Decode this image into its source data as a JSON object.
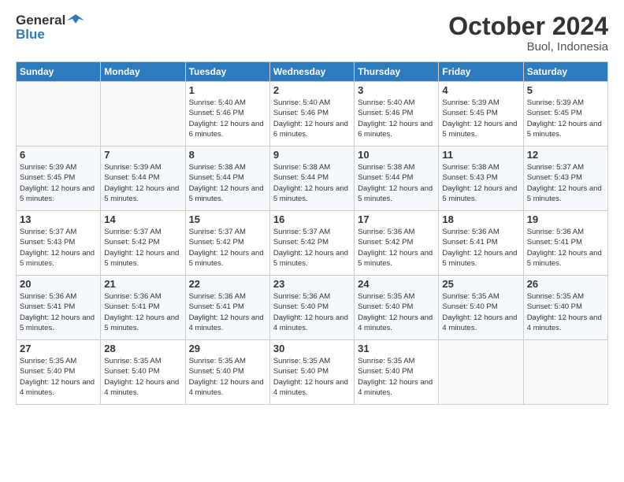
{
  "logo": {
    "text_general": "General",
    "text_blue": "Blue"
  },
  "title": "October 2024",
  "subtitle": "Buol, Indonesia",
  "days_of_week": [
    "Sunday",
    "Monday",
    "Tuesday",
    "Wednesday",
    "Thursday",
    "Friday",
    "Saturday"
  ],
  "weeks": [
    [
      {
        "day": "",
        "sunrise": "",
        "sunset": "",
        "daylight": ""
      },
      {
        "day": "",
        "sunrise": "",
        "sunset": "",
        "daylight": ""
      },
      {
        "day": "1",
        "sunrise": "Sunrise: 5:40 AM",
        "sunset": "Sunset: 5:46 PM",
        "daylight": "Daylight: 12 hours and 6 minutes."
      },
      {
        "day": "2",
        "sunrise": "Sunrise: 5:40 AM",
        "sunset": "Sunset: 5:46 PM",
        "daylight": "Daylight: 12 hours and 6 minutes."
      },
      {
        "day": "3",
        "sunrise": "Sunrise: 5:40 AM",
        "sunset": "Sunset: 5:46 PM",
        "daylight": "Daylight: 12 hours and 6 minutes."
      },
      {
        "day": "4",
        "sunrise": "Sunrise: 5:39 AM",
        "sunset": "Sunset: 5:45 PM",
        "daylight": "Daylight: 12 hours and 5 minutes."
      },
      {
        "day": "5",
        "sunrise": "Sunrise: 5:39 AM",
        "sunset": "Sunset: 5:45 PM",
        "daylight": "Daylight: 12 hours and 5 minutes."
      }
    ],
    [
      {
        "day": "6",
        "sunrise": "Sunrise: 5:39 AM",
        "sunset": "Sunset: 5:45 PM",
        "daylight": "Daylight: 12 hours and 5 minutes."
      },
      {
        "day": "7",
        "sunrise": "Sunrise: 5:39 AM",
        "sunset": "Sunset: 5:44 PM",
        "daylight": "Daylight: 12 hours and 5 minutes."
      },
      {
        "day": "8",
        "sunrise": "Sunrise: 5:38 AM",
        "sunset": "Sunset: 5:44 PM",
        "daylight": "Daylight: 12 hours and 5 minutes."
      },
      {
        "day": "9",
        "sunrise": "Sunrise: 5:38 AM",
        "sunset": "Sunset: 5:44 PM",
        "daylight": "Daylight: 12 hours and 5 minutes."
      },
      {
        "day": "10",
        "sunrise": "Sunrise: 5:38 AM",
        "sunset": "Sunset: 5:44 PM",
        "daylight": "Daylight: 12 hours and 5 minutes."
      },
      {
        "day": "11",
        "sunrise": "Sunrise: 5:38 AM",
        "sunset": "Sunset: 5:43 PM",
        "daylight": "Daylight: 12 hours and 5 minutes."
      },
      {
        "day": "12",
        "sunrise": "Sunrise: 5:37 AM",
        "sunset": "Sunset: 5:43 PM",
        "daylight": "Daylight: 12 hours and 5 minutes."
      }
    ],
    [
      {
        "day": "13",
        "sunrise": "Sunrise: 5:37 AM",
        "sunset": "Sunset: 5:43 PM",
        "daylight": "Daylight: 12 hours and 5 minutes."
      },
      {
        "day": "14",
        "sunrise": "Sunrise: 5:37 AM",
        "sunset": "Sunset: 5:42 PM",
        "daylight": "Daylight: 12 hours and 5 minutes."
      },
      {
        "day": "15",
        "sunrise": "Sunrise: 5:37 AM",
        "sunset": "Sunset: 5:42 PM",
        "daylight": "Daylight: 12 hours and 5 minutes."
      },
      {
        "day": "16",
        "sunrise": "Sunrise: 5:37 AM",
        "sunset": "Sunset: 5:42 PM",
        "daylight": "Daylight: 12 hours and 5 minutes."
      },
      {
        "day": "17",
        "sunrise": "Sunrise: 5:36 AM",
        "sunset": "Sunset: 5:42 PM",
        "daylight": "Daylight: 12 hours and 5 minutes."
      },
      {
        "day": "18",
        "sunrise": "Sunrise: 5:36 AM",
        "sunset": "Sunset: 5:41 PM",
        "daylight": "Daylight: 12 hours and 5 minutes."
      },
      {
        "day": "19",
        "sunrise": "Sunrise: 5:36 AM",
        "sunset": "Sunset: 5:41 PM",
        "daylight": "Daylight: 12 hours and 5 minutes."
      }
    ],
    [
      {
        "day": "20",
        "sunrise": "Sunrise: 5:36 AM",
        "sunset": "Sunset: 5:41 PM",
        "daylight": "Daylight: 12 hours and 5 minutes."
      },
      {
        "day": "21",
        "sunrise": "Sunrise: 5:36 AM",
        "sunset": "Sunset: 5:41 PM",
        "daylight": "Daylight: 12 hours and 5 minutes."
      },
      {
        "day": "22",
        "sunrise": "Sunrise: 5:36 AM",
        "sunset": "Sunset: 5:41 PM",
        "daylight": "Daylight: 12 hours and 4 minutes."
      },
      {
        "day": "23",
        "sunrise": "Sunrise: 5:36 AM",
        "sunset": "Sunset: 5:40 PM",
        "daylight": "Daylight: 12 hours and 4 minutes."
      },
      {
        "day": "24",
        "sunrise": "Sunrise: 5:35 AM",
        "sunset": "Sunset: 5:40 PM",
        "daylight": "Daylight: 12 hours and 4 minutes."
      },
      {
        "day": "25",
        "sunrise": "Sunrise: 5:35 AM",
        "sunset": "Sunset: 5:40 PM",
        "daylight": "Daylight: 12 hours and 4 minutes."
      },
      {
        "day": "26",
        "sunrise": "Sunrise: 5:35 AM",
        "sunset": "Sunset: 5:40 PM",
        "daylight": "Daylight: 12 hours and 4 minutes."
      }
    ],
    [
      {
        "day": "27",
        "sunrise": "Sunrise: 5:35 AM",
        "sunset": "Sunset: 5:40 PM",
        "daylight": "Daylight: 12 hours and 4 minutes."
      },
      {
        "day": "28",
        "sunrise": "Sunrise: 5:35 AM",
        "sunset": "Sunset: 5:40 PM",
        "daylight": "Daylight: 12 hours and 4 minutes."
      },
      {
        "day": "29",
        "sunrise": "Sunrise: 5:35 AM",
        "sunset": "Sunset: 5:40 PM",
        "daylight": "Daylight: 12 hours and 4 minutes."
      },
      {
        "day": "30",
        "sunrise": "Sunrise: 5:35 AM",
        "sunset": "Sunset: 5:40 PM",
        "daylight": "Daylight: 12 hours and 4 minutes."
      },
      {
        "day": "31",
        "sunrise": "Sunrise: 5:35 AM",
        "sunset": "Sunset: 5:40 PM",
        "daylight": "Daylight: 12 hours and 4 minutes."
      },
      {
        "day": "",
        "sunrise": "",
        "sunset": "",
        "daylight": ""
      },
      {
        "day": "",
        "sunrise": "",
        "sunset": "",
        "daylight": ""
      }
    ]
  ]
}
